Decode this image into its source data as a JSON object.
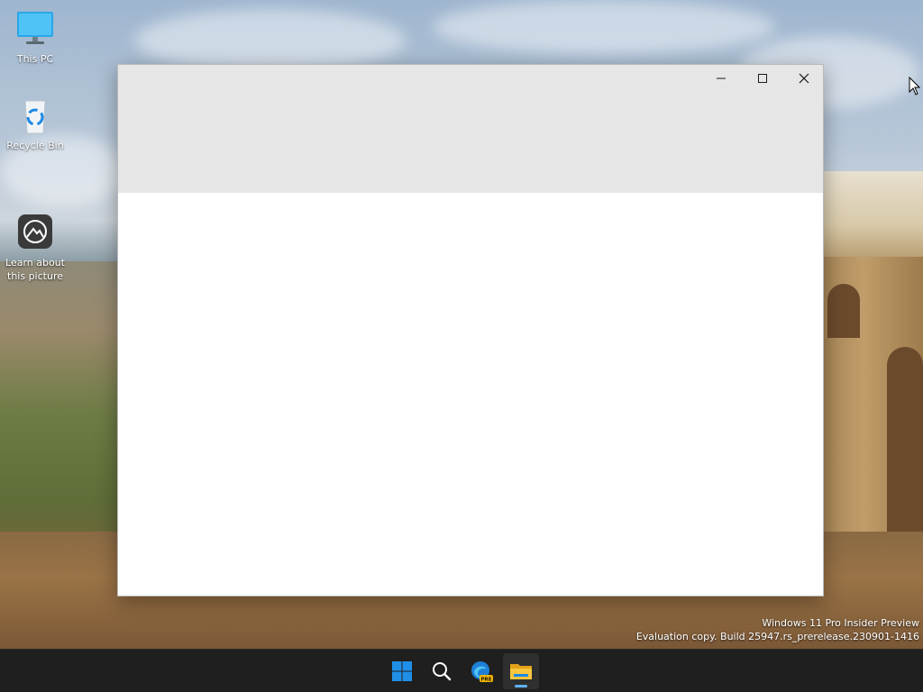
{
  "desktop": {
    "icons": [
      {
        "label": "This PC",
        "icon": "monitor-icon"
      },
      {
        "label": "Recycle Bin",
        "icon": "recycle-bin-icon"
      },
      {
        "label": "Learn about\nthis picture",
        "icon": "learn-picture-icon"
      }
    ],
    "watermark": {
      "line1": "Windows 11 Pro Insider Preview",
      "line2": "Evaluation copy. Build 25947.rs_prerelease.230901-1416"
    }
  },
  "window": {
    "controls": {
      "minimize": "minimize-icon",
      "maximize": "maximize-icon",
      "close": "close-icon"
    },
    "colors": {
      "titlebar": "#e6e6e6",
      "body": "#ffffff"
    }
  },
  "taskbar": {
    "items": [
      {
        "icon": "windows-start-icon",
        "active": false
      },
      {
        "icon": "search-icon",
        "active": false
      },
      {
        "icon": "edge-preview-icon",
        "badge": "PRE",
        "active": false
      },
      {
        "icon": "file-explorer-icon",
        "active": true
      }
    ],
    "colors": {
      "background": "#1f1f1f",
      "start_blue": "#1f8fe8",
      "indicator": "#5fb2f2"
    }
  }
}
